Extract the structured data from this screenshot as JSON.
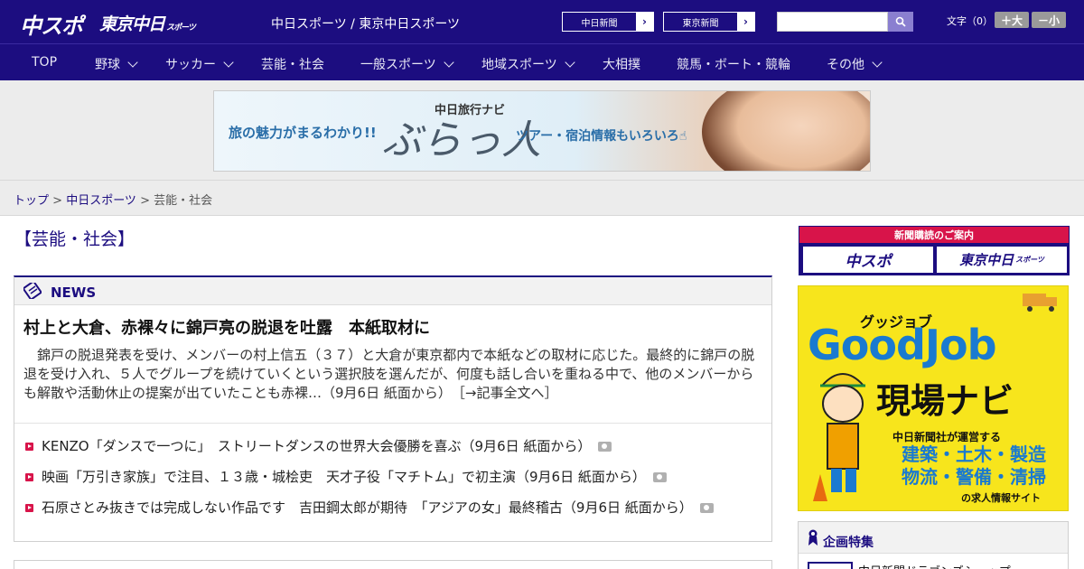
{
  "header": {
    "logo_chuspo": "中スポ",
    "logo_tokyo": "東京中日",
    "logo_tokyo_sub": "スポーツ",
    "site_links": "中日スポーツ / 東京中日スポーツ",
    "paper_buttons": [
      {
        "label": "中日新聞"
      },
      {
        "label": "東京新聞"
      }
    ],
    "search_placeholder": "",
    "font_size_label": "文字（0）",
    "font_larger": "＋大",
    "font_smaller": "－小"
  },
  "nav": {
    "items": [
      {
        "label": "TOP",
        "dropdown": false
      },
      {
        "label": "野球",
        "dropdown": true
      },
      {
        "label": "サッカー",
        "dropdown": true
      },
      {
        "label": "芸能・社会",
        "dropdown": false
      },
      {
        "label": "一般スポーツ",
        "dropdown": true
      },
      {
        "label": "地域スポーツ",
        "dropdown": true
      },
      {
        "label": "大相撲",
        "dropdown": false
      },
      {
        "label": "競馬・ボート・競輪",
        "dropdown": false
      },
      {
        "label": "その他",
        "dropdown": true
      }
    ]
  },
  "banner": {
    "left_text": "旅の魅力がまるわかり!!",
    "sub_title": "中日旅行ナビ",
    "main_title": "ぶらっ人",
    "right_text": "ツアー・宿泊情報もいろいろ☝"
  },
  "breadcrumb": {
    "top": "トップ",
    "sep1": " > ",
    "category": "中日スポーツ",
    "sep2": " > ",
    "current": "芸能・社会"
  },
  "section": {
    "title": "【芸能・社会】"
  },
  "news": {
    "label": "NEWS",
    "headline": "村上と大倉、赤裸々に錦戸亮の脱退を吐露　本紙取材に",
    "lead": "錦戸の脱退発表を受け、メンバーの村上信五（３７）と大倉が東京都内で本紙などの取材に応じた。最終的に錦戸の脱退を受け入れ、５人でグループを続けていくという選択肢を選んだが、何度も話し合いを重ねる中で、他のメンバーからも解散や活動休止の提案が出ていたことも赤裸…（9月6日 紙面から）",
    "more_link": "［→記事全文へ］",
    "items": [
      {
        "text": "KENZO「ダンスで一つに」　ストリートダンスの世界大会優勝を喜ぶ（9月6日 紙面から）",
        "has_photo": true
      },
      {
        "text": "映画「万引き家族」で注目、１３歳・城桧吏　天才子役「マチトム」で初主演（9月6日 紙面から）",
        "has_photo": true
      },
      {
        "text": "石原さとみ抜きでは完成しない作品です　吉田鋼太郎が期待　「アジアの女」最終稽古（9月6日 紙面から）",
        "has_photo": true
      }
    ]
  },
  "sidebar": {
    "subscription": {
      "head": "新聞購読のご案内",
      "btn_chuspo": "中スポ",
      "btn_tokyo": "東京中日",
      "btn_tokyo_sub": "スポーツ"
    },
    "goodjob": {
      "kana": "グッジョブ",
      "title": "GoodJob",
      "navi": "現場ナビ",
      "sub": "中日新聞社が運営する",
      "fields_line1": "建築・土木・製造",
      "fields_line2": "物流・警備・清掃",
      "site": "の求人情報サイト"
    },
    "kikaku": {
      "label": "企画特集",
      "item": "中日新聞ドラゴンズショップ"
    }
  },
  "colors": {
    "brand_navy": "#1c0d80",
    "accent_red": "#d8144a",
    "goodjob_yellow": "#f7e51c",
    "goodjob_blue": "#1a7ad0"
  }
}
